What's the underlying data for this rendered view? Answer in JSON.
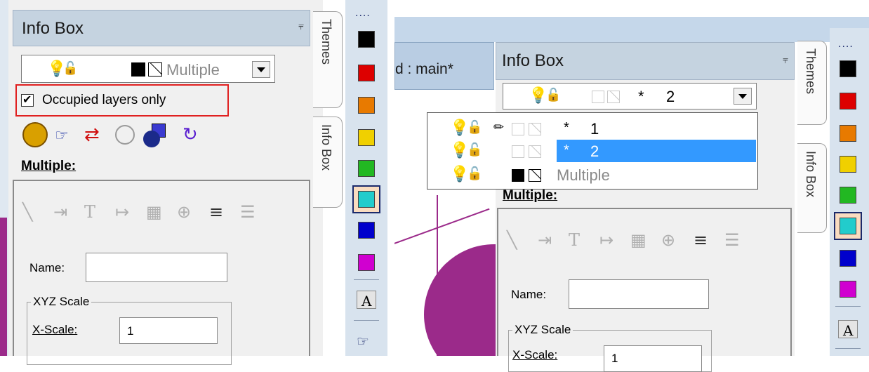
{
  "left": {
    "title": "Info Box",
    "pin_icon": "pin-icon",
    "layer_combo": {
      "value": "Multiple"
    },
    "occupied_checkbox": {
      "label": "Occupied layers only",
      "checked": true
    },
    "section_label": "Multiple:",
    "name_label": "Name:",
    "name_value": "",
    "xyz_group": "XYZ Scale",
    "xscale_label": "X-Scale:",
    "xscale_value": "1",
    "tabs": [
      "Themes",
      "Info Box"
    ],
    "highlight_color": "#e02020"
  },
  "right": {
    "window_title": "d : main*",
    "title": "Info Box",
    "layer_combo": {
      "star": "*",
      "value": "2"
    },
    "layers": [
      {
        "star": "*",
        "label": "1",
        "pencil": true
      },
      {
        "star": "*",
        "label": "2",
        "selected": true
      },
      {
        "star": "",
        "label": "Multiple"
      }
    ],
    "section_label": "Multiple:",
    "name_label": "Name:",
    "name_value": "",
    "xyz_group": "XYZ Scale",
    "xscale_label": "X-Scale:",
    "xscale_value": "1",
    "tabs": [
      "Themes",
      "Info Box"
    ]
  },
  "palette": {
    "dots": "....",
    "colors": [
      "#000000",
      "#dd0000",
      "#e87a00",
      "#f0d000",
      "#22b822",
      "#22cccc",
      "#0000cc",
      "#d000d0"
    ],
    "selected_index": 5,
    "text_tool": "A"
  },
  "accent_colors": {
    "header": "#c5d3e0",
    "selection": "#3399ff",
    "canvas_purple": "#9b2a8a"
  }
}
